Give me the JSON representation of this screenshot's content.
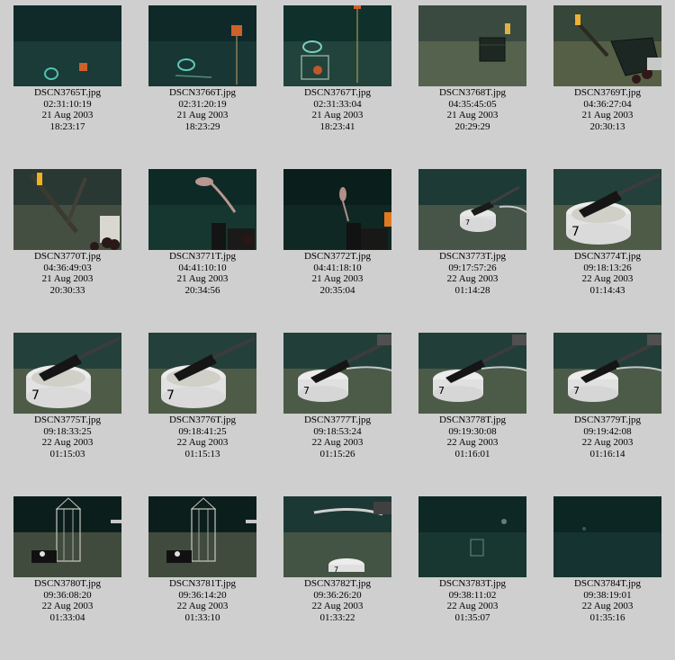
{
  "rows": [
    [
      {
        "file": "DSCN3765T.jpg",
        "time": "02:31:10:19",
        "date": "21 Aug 2003",
        "clock": "18:23:17",
        "scene": "dark-ring"
      },
      {
        "file": "DSCN3766T.jpg",
        "time": "02:31:20:19",
        "date": "21 Aug 2003",
        "clock": "18:23:29",
        "scene": "dark-ring-box"
      },
      {
        "file": "DSCN3767T.jpg",
        "time": "02:31:33:04",
        "date": "21 Aug 2003",
        "clock": "18:23:41",
        "scene": "dark-rig"
      },
      {
        "file": "DSCN3768T.jpg",
        "time": "04:35:45:05",
        "date": "21 Aug 2003",
        "clock": "20:29:29",
        "scene": "sand-crate"
      },
      {
        "file": "DSCN3769T.jpg",
        "time": "04:36:27:04",
        "date": "21 Aug 2003",
        "clock": "20:30:13",
        "scene": "sand-arm-crate"
      }
    ],
    [
      {
        "file": "DSCN3770T.jpg",
        "time": "04:36:49:03",
        "date": "21 Aug 2003",
        "clock": "20:30:33",
        "scene": "sand-arm-bottles"
      },
      {
        "file": "DSCN3771T.jpg",
        "time": "04:41:10:10",
        "date": "21 Aug 2003",
        "clock": "20:34:56",
        "scene": "fish-bottles"
      },
      {
        "file": "DSCN3772T.jpg",
        "time": "04:41:18:10",
        "date": "21 Aug 2003",
        "clock": "20:35:04",
        "scene": "fish-bottles-dark"
      },
      {
        "file": "DSCN3773T.jpg",
        "time": "09:17:57:26",
        "date": "22 Aug 2003",
        "clock": "01:14:28",
        "scene": "bucket-far"
      },
      {
        "file": "DSCN3774T.jpg",
        "time": "09:18:13:26",
        "date": "22 Aug 2003",
        "clock": "01:14:43",
        "scene": "bucket-near"
      }
    ],
    [
      {
        "file": "DSCN3775T.jpg",
        "time": "09:18:33:25",
        "date": "22 Aug 2003",
        "clock": "01:15:03",
        "scene": "bucket-near"
      },
      {
        "file": "DSCN3776T.jpg",
        "time": "09:18:41:25",
        "date": "22 Aug 2003",
        "clock": "01:15:13",
        "scene": "bucket-near"
      },
      {
        "file": "DSCN3777T.jpg",
        "time": "09:18:53:24",
        "date": "22 Aug 2003",
        "clock": "01:15:26",
        "scene": "bucket-mid"
      },
      {
        "file": "DSCN3778T.jpg",
        "time": "09:19:30:08",
        "date": "22 Aug 2003",
        "clock": "01:16:01",
        "scene": "bucket-mid"
      },
      {
        "file": "DSCN3779T.jpg",
        "time": "09:19:42:08",
        "date": "22 Aug 2003",
        "clock": "01:16:14",
        "scene": "bucket-mid"
      }
    ],
    [
      {
        "file": "DSCN3780T.jpg",
        "time": "09:36:08:20",
        "date": "22 Aug 2003",
        "clock": "01:33:04",
        "scene": "cage"
      },
      {
        "file": "DSCN3781T.jpg",
        "time": "09:36:14:20",
        "date": "22 Aug 2003",
        "clock": "01:33:10",
        "scene": "cage"
      },
      {
        "file": "DSCN3782T.jpg",
        "time": "09:36:26:20",
        "date": "22 Aug 2003",
        "clock": "01:33:22",
        "scene": "bucket-arm-far"
      },
      {
        "file": "DSCN3783T.jpg",
        "time": "09:38:11:02",
        "date": "22 Aug 2003",
        "clock": "01:35:07",
        "scene": "dim-far"
      },
      {
        "file": "DSCN3784T.jpg",
        "time": "09:38:19:01",
        "date": "22 Aug 2003",
        "clock": "01:35:16",
        "scene": "dim-empty"
      }
    ]
  ]
}
